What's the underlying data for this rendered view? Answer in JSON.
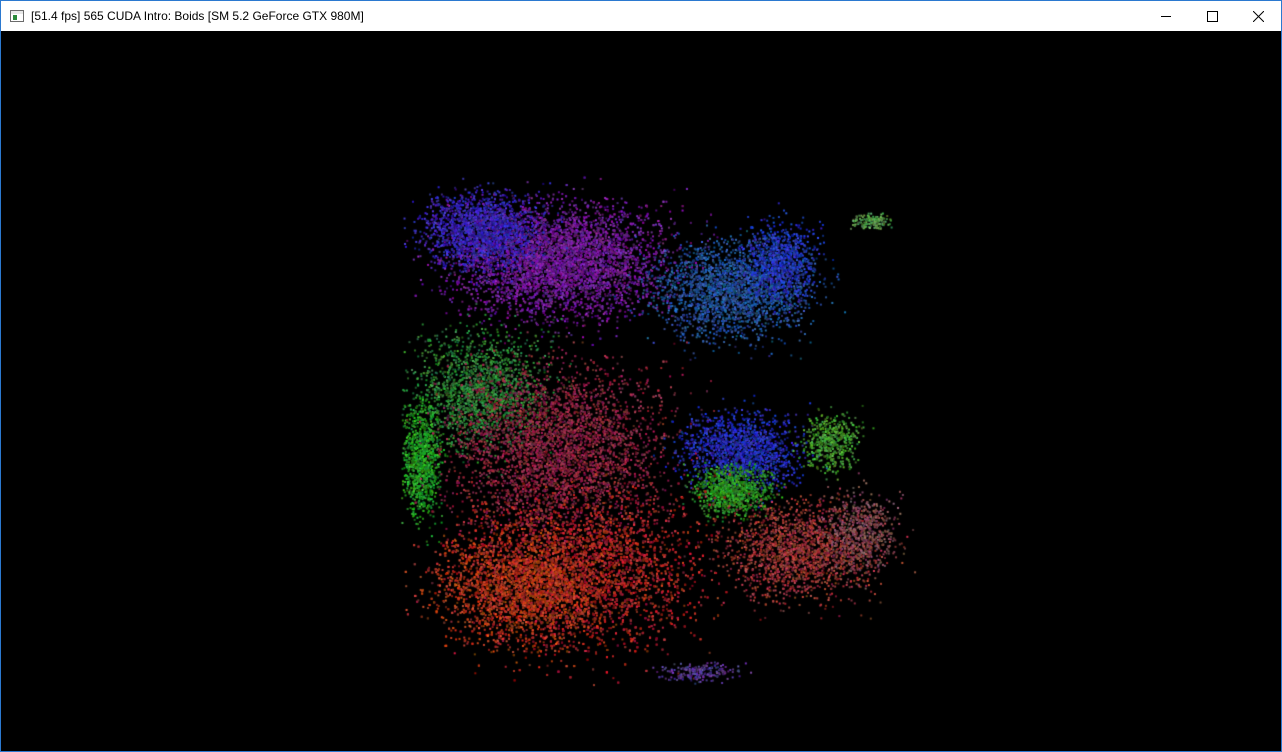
{
  "window": {
    "title": "[51.4 fps] 565 CUDA Intro: Boids [SM 5.2 GeForce GTX 980M]",
    "app_icon": "application-window-icon",
    "controls": {
      "minimize_icon": "minimize-icon",
      "maximize_icon": "maximize-icon",
      "close_icon": "close-icon"
    },
    "accent_color": "#2b79d0"
  },
  "scene": {
    "background_color": "#000000",
    "particle_palette": [
      "#7a1fa0",
      "#2840c8",
      "#2a9a30",
      "#b02828",
      "#c23a1a",
      "#3a7aa0"
    ]
  }
}
